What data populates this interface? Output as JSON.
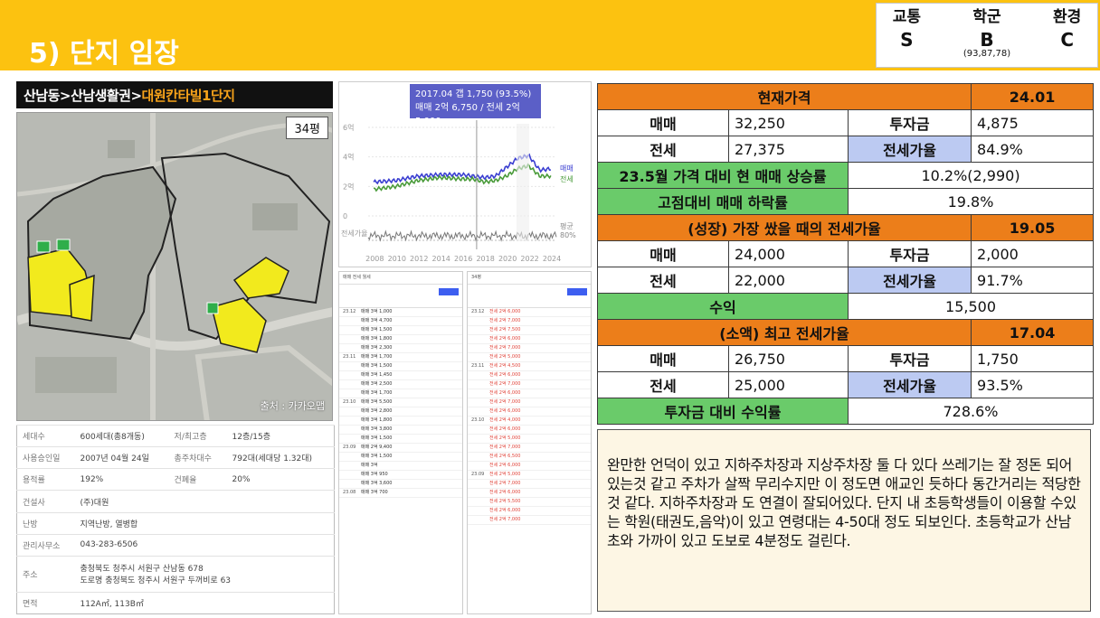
{
  "page": {
    "title": "5) 단지 임장"
  },
  "grades": {
    "headers": [
      "교통",
      "학군",
      "환경"
    ],
    "values": [
      "S",
      "B",
      "C"
    ],
    "school_detail": "(93,87,78)"
  },
  "breadcrumb": {
    "path": "산남동>산남생활권>",
    "complex": "대원칸타빌1단지"
  },
  "map": {
    "size_badge": "34평",
    "credit": "출처 : 카카오맵",
    "fill_color": "#f2ea1d",
    "building_color": "#2fae4a"
  },
  "info_table": {
    "rows": [
      {
        "k1": "세대수",
        "v1": "600세대(총8개동)",
        "k2": "저/최고층",
        "v2": "12층/15층"
      },
      {
        "k1": "사용승인일",
        "v1": "2007년 04월 24일",
        "k2": "총주차대수",
        "v2": "792대(세대당 1.32대)"
      },
      {
        "k1": "용적률",
        "v1": "192%",
        "k2": "건폐율",
        "v2": "20%"
      },
      {
        "k1": "건설사",
        "v1": "(주)대원",
        "k2": "",
        "v2": ""
      },
      {
        "k1": "난방",
        "v1": "지역난방, 열병합",
        "k2": "",
        "v2": ""
      },
      {
        "k1": "관리사무소",
        "v1": "043-283-6506",
        "k2": "",
        "v2": ""
      },
      {
        "k1": "주소",
        "v1": "충청북도 청주시 서원구 산남동 678",
        "v1b": "도로명 충청북도 청주시 서원구 두꺼비로 63"
      },
      {
        "k1": "면적",
        "v1": "112A㎡, 113B㎡"
      }
    ]
  },
  "chart_data": {
    "type": "line",
    "tooltip": {
      "line1": "2017.04  갭 1,750 (93.5%)",
      "line2": "매매 2억 6,750 / 전세 2억 5,000"
    },
    "x_ticks": [
      "2008",
      "2010",
      "2012",
      "2014",
      "2016",
      "2018",
      "2020",
      "2022",
      "2024"
    ],
    "y_ticks": [
      "6억",
      "4억",
      "2억",
      "0"
    ],
    "lower_label": "전세가율",
    "right_labels": [
      "매매",
      "전세",
      "평균",
      "80%"
    ],
    "series": [
      {
        "name": "매매",
        "color": "#3b3fd1",
        "x": [
          2008,
          2010,
          2012,
          2014,
          2016,
          2017,
          2018,
          2019,
          2020,
          2021,
          2022,
          2023,
          2024
        ],
        "values": [
          2.3,
          2.4,
          2.7,
          2.8,
          2.8,
          2.7,
          2.6,
          2.7,
          3.3,
          3.9,
          4.1,
          3.1,
          3.2
        ]
      },
      {
        "name": "전세",
        "color": "#4a9b3a",
        "x": [
          2008,
          2010,
          2012,
          2014,
          2016,
          2017,
          2018,
          2019,
          2020,
          2021,
          2022,
          2023,
          2024
        ],
        "values": [
          1.8,
          2.0,
          2.4,
          2.6,
          2.5,
          2.5,
          2.3,
          2.4,
          2.7,
          3.2,
          3.4,
          2.7,
          2.7
        ]
      }
    ],
    "ylim": [
      0,
      6
    ]
  },
  "listing_left": {
    "header": "매매  전세  월세",
    "dates": [
      "23.12",
      "23.11",
      "23.10",
      "23.09",
      "23.08"
    ],
    "rows": [
      "매매 3억 1,000",
      "매매 3억 4,700",
      "매매 3억 1,500",
      "매매 3억 1,800",
      "매매 3억 2,300",
      "매매 3억 1,700",
      "매매 3억 1,500",
      "매매 3억 1,450",
      "매매 3억 2,500",
      "매매 3억 1,700",
      "매매 3억 5,500",
      "매매 3억 2,800",
      "매매 3억 1,800",
      "매매 3억 3,800",
      "매매 3억 1,500",
      "매매 2억 9,400",
      "매매 3억 1,500",
      "매매 3억",
      "매매 3억 950",
      "매매 3억 3,600",
      "매매 3억 700"
    ]
  },
  "listing_right": {
    "header": "34평",
    "dates": [
      "23.12",
      "23.11",
      "23.10",
      "23.09"
    ],
    "rows": [
      "전세 2억 6,000",
      "전세 2억 7,000",
      "전세 2억 7,500",
      "전세 2억 6,000",
      "전세 2억 7,000",
      "전세 2억 5,000",
      "전세 2억 4,500",
      "전세 2억 6,000",
      "전세 2억 7,000",
      "전세 2억 6,000",
      "전세 2억 7,000",
      "전세 2억 6,000",
      "전세 2억 4,000",
      "전세 2억 6,000",
      "전세 2억 5,000",
      "전세 2억 7,000",
      "전세 2억 6,500",
      "전세 2억 6,000",
      "전세 2억 5,000",
      "전세 2억 7,000",
      "전세 2억 6,000",
      "전세 2억 5,500",
      "전세 2억 6,000",
      "전세 2억 7,000"
    ]
  },
  "price_table": {
    "current": {
      "label": "현재가격",
      "date": "24.01"
    },
    "r1": {
      "a": "매매",
      "b": "32,250",
      "c": "투자금",
      "d": "4,875"
    },
    "r2": {
      "a": "전세",
      "b": "27,375",
      "c": "전세가율",
      "d": "84.9%"
    },
    "rise": {
      "label": "23.5월 가격 대비 현 매매 상승률",
      "value": "10.2%(2,990)"
    },
    "drop": {
      "label": "고점대비 매매 하락률",
      "value": "19.8%"
    },
    "growth": {
      "label": "(성장) 가장 쌌을 때의 전세가율",
      "date": "19.05"
    },
    "r3": {
      "a": "매매",
      "b": "24,000",
      "c": "투자금",
      "d": "2,000"
    },
    "r4": {
      "a": "전세",
      "b": "22,000",
      "c": "전세가율",
      "d": "91.7%"
    },
    "profit": {
      "label": "수익",
      "value": "15,500"
    },
    "shrink": {
      "label": "(소액) 최고 전세가율",
      "date": "17.04"
    },
    "r5": {
      "a": "매매",
      "b": "26,750",
      "c": "투자금",
      "d": "1,750"
    },
    "r6": {
      "a": "전세",
      "b": "25,000",
      "c": "전세가율",
      "d": "93.5%"
    },
    "roi": {
      "label": "투자금 대비 수익률",
      "value": "728.6%"
    }
  },
  "note": {
    "text": "완만한 언덕이 있고 지하주차장과 지상주차장 둘 다 있다 쓰레기는 잘 정돈 되어있는것 같고 주차가 살짝 무리수지만 이 정도면 애교인 듯하다 동간거리는 적당한것 같다. 지하주차장과 도 연결이 잘되어있다. 단지 내 초등학생들이 이용할 수있는 학원(태권도,음악)이 있고 연령대는 4-50대 정도 되보인다. 초등학교가 산남초와 가까이 있고 도보로 4분정도 걸린다."
  }
}
